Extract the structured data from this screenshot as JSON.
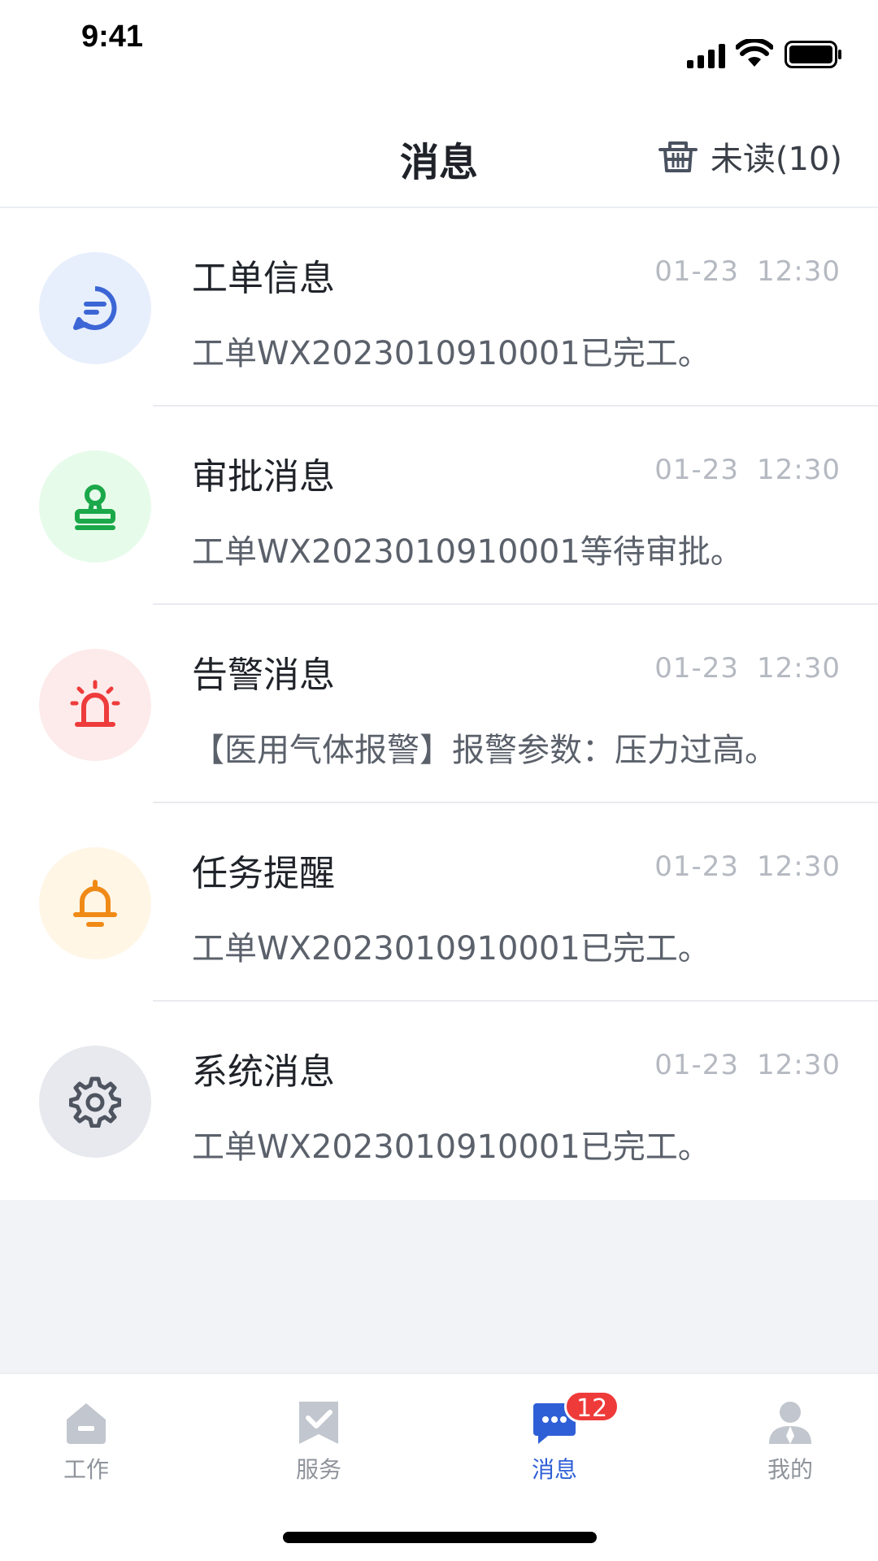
{
  "status_bar": {
    "time": "9:41"
  },
  "header": {
    "title": "消息",
    "unread_label": "未读(10)"
  },
  "messages": [
    {
      "title": "工单信息",
      "date": "01-23",
      "time": "12:30",
      "desc": "工单WX2023010910001已完工。",
      "icon": "chat-bubble-icon",
      "icon_color": "#3c66d6",
      "bg": "#e8effc"
    },
    {
      "title": "审批消息",
      "date": "01-23",
      "time": "12:30",
      "desc": "工单WX2023010910001等待审批。",
      "icon": "stamp-icon",
      "icon_color": "#1ba84a",
      "bg": "#e7fbea"
    },
    {
      "title": "告警消息",
      "date": "01-23",
      "time": "12:30",
      "desc": "【医用气体报警】报警参数：压力过高。",
      "icon": "alarm-light-icon",
      "icon_color": "#ee3b3b",
      "bg": "#fdebeb"
    },
    {
      "title": "任务提醒",
      "date": "01-23",
      "time": "12:30",
      "desc": "工单WX2023010910001已完工。",
      "icon": "bell-icon",
      "icon_color": "#f08a16",
      "bg": "#fff6e6"
    },
    {
      "title": "系统消息",
      "date": "01-23",
      "time": "12:30",
      "desc": "工单WX2023010910001已完工。",
      "icon": "gear-icon",
      "icon_color": "#4f5560",
      "bg": "#e7e9ee"
    }
  ],
  "tabs": [
    {
      "label": "工作",
      "icon": "home-icon",
      "active": false
    },
    {
      "label": "服务",
      "icon": "checkmark-flag-icon",
      "active": false
    },
    {
      "label": "消息",
      "icon": "message-icon",
      "active": true,
      "badge": "12"
    },
    {
      "label": "我的",
      "icon": "user-icon",
      "active": false
    }
  ],
  "colors": {
    "accent": "#2f5fd7",
    "badge": "#ef3a3a",
    "inactive_tab": "#c2c6ce"
  }
}
